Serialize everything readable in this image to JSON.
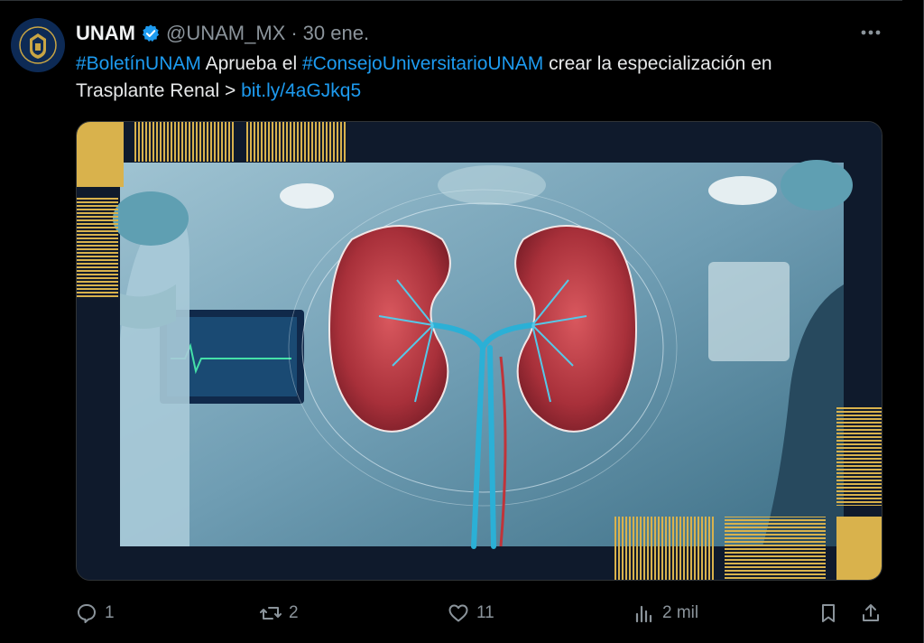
{
  "author": {
    "name": "UNAM",
    "handle": "@UNAM_MX",
    "separator": "·",
    "date": "30 ene."
  },
  "tweet": {
    "hashtag1": "#BoletínUNAM",
    "text1": " Aprueba el ",
    "hashtag2": "#ConsejoUniversitarioUNAM",
    "text2": " crear la especialización en",
    "text3": "Trasplante Renal > ",
    "link": "bit.ly/4aGJkq5"
  },
  "actions": {
    "replies": "1",
    "reposts": "2",
    "likes": "11",
    "views": "2 mil"
  },
  "colors": {
    "accent": "#1d9bf0",
    "muted": "#8b949b",
    "gold": "#d9b24c"
  }
}
